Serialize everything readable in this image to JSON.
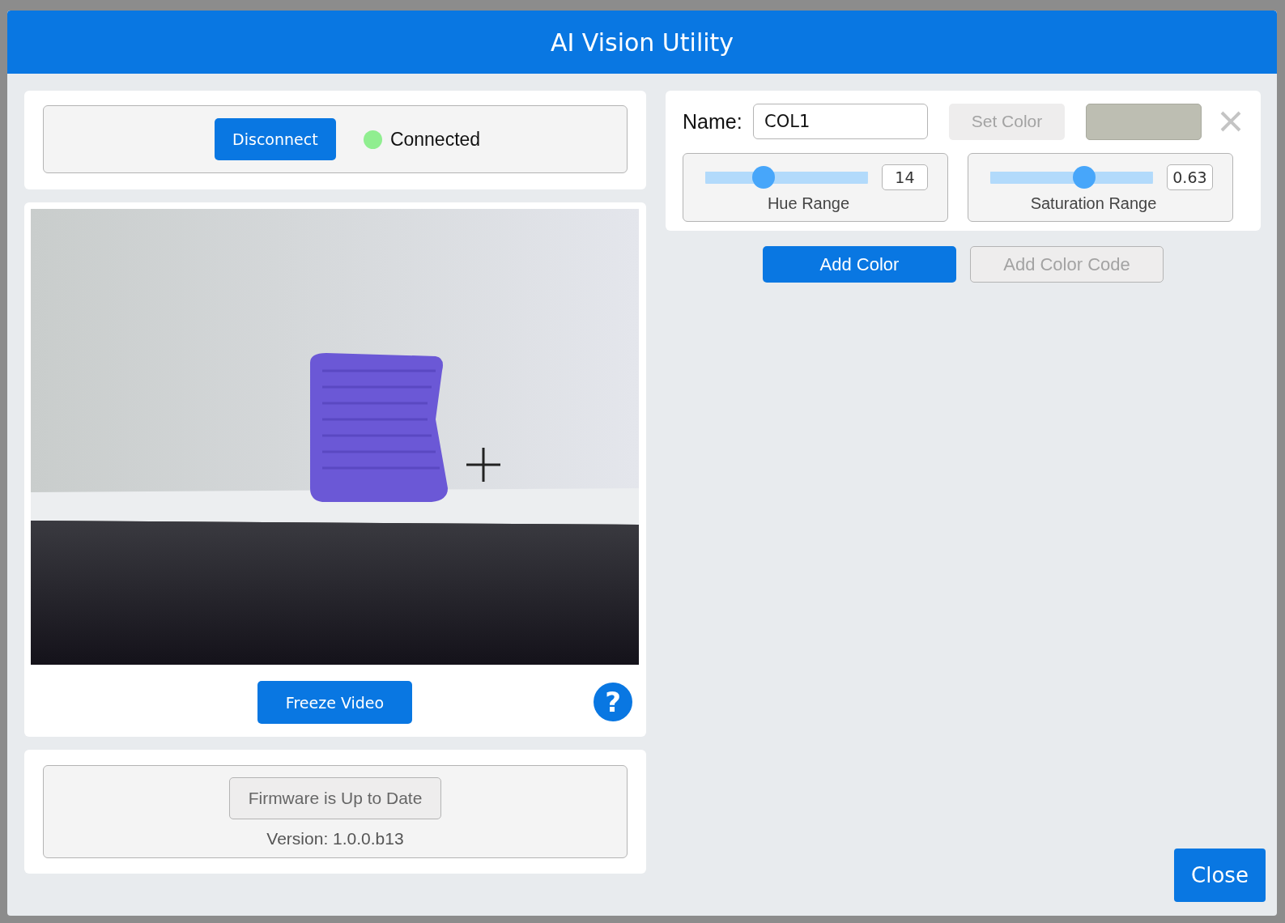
{
  "window": {
    "title": "AI Vision Utility"
  },
  "connection": {
    "button": "Disconnect",
    "status": "Connected",
    "connected": true
  },
  "video": {
    "freeze_button": "Freeze Video",
    "help": "?"
  },
  "firmware": {
    "button": "Firmware is Up to Date",
    "version": "Version: 1.0.0.b13"
  },
  "color_editor": {
    "name_label": "Name:",
    "name_value": "COL1",
    "set_color": {
      "label": "Set Color",
      "disabled": true
    },
    "swatch": {
      "color": "#bdbeb2"
    },
    "sliders": [
      {
        "label": "Hue Range",
        "level": 0.36,
        "reading": "14"
      },
      {
        "label": "Saturation Range",
        "level": 0.58,
        "reading": "0.63"
      }
    ]
  },
  "actions": [
    {
      "label": "Add Color",
      "disabled": false
    },
    {
      "label": "Add Color Code",
      "disabled": true
    }
  ],
  "close_button": "Close"
}
